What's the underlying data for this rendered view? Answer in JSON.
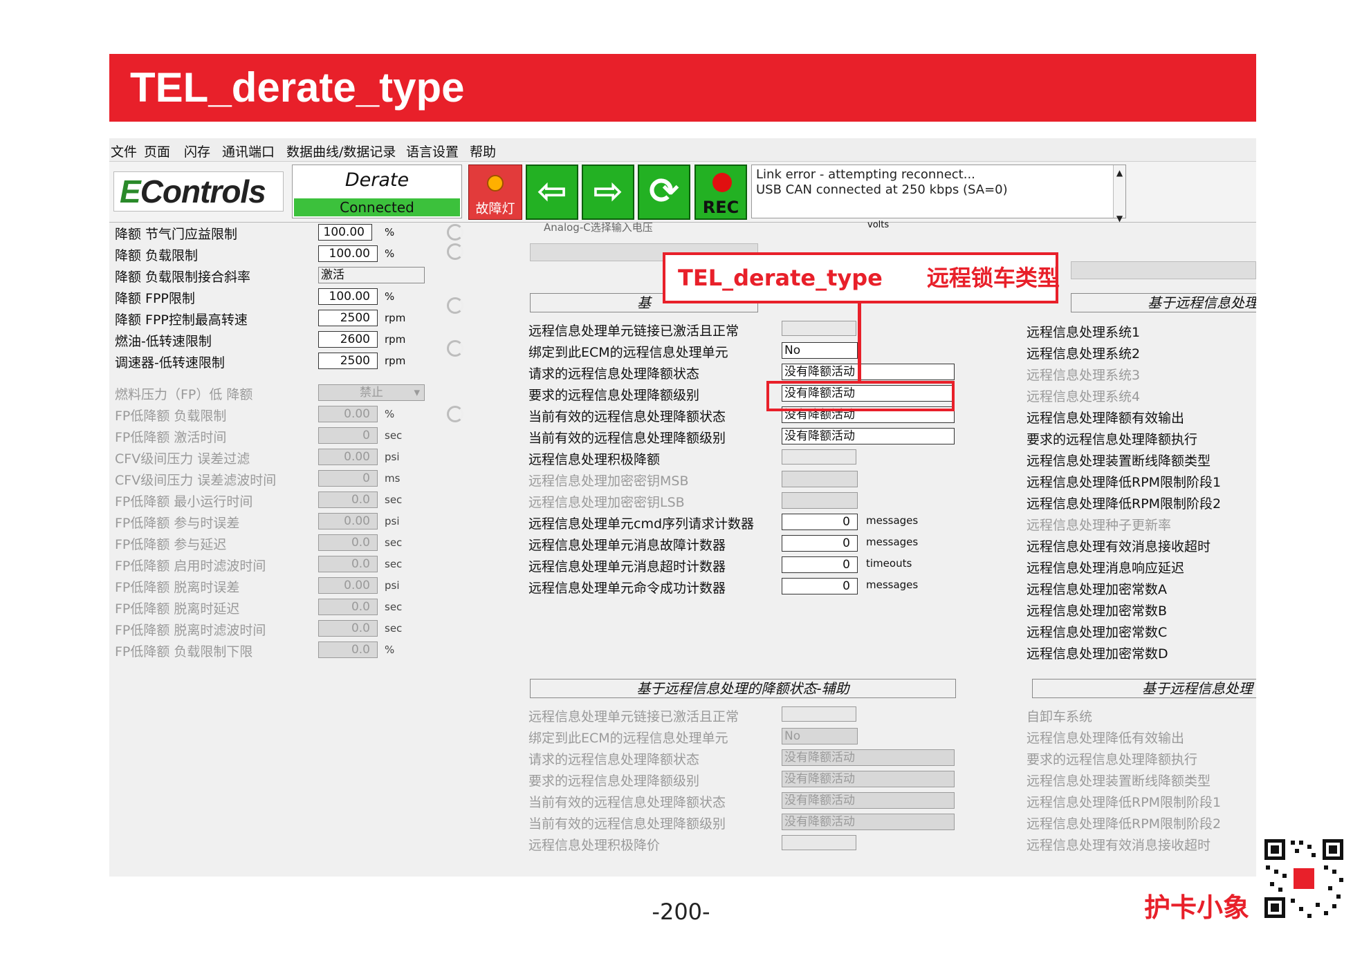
{
  "title": "TEL_derate_type",
  "menu": [
    "文件",
    "页面",
    "闪存",
    "通讯端口",
    "数据曲线/数据记录",
    "语言设置",
    "帮助"
  ],
  "toolbar": {
    "logo": "Controls",
    "status_title": "Derate",
    "status_connection": "Connected",
    "fault_label": "故障灯",
    "rec_label": "REC",
    "back_glyph": "⇦",
    "forward_glyph": "⇨",
    "refresh_glyph": "⟳",
    "log_lines": [
      "Link error - attempting reconnect...",
      "USB CAN connected at 250 kbps (SA=0)"
    ]
  },
  "left_panel": [
    {
      "label": "降额 节气门应益限制",
      "value": "100.00",
      "unit": "%",
      "dim": false
    },
    {
      "label": "降额 负载限制",
      "value": "100.00",
      "unit": "%",
      "dim": false
    },
    {
      "label": "降额 负载限制接合斜率",
      "value": "激活",
      "unit": "",
      "dim": false
    },
    {
      "label": "降额 FPP限制",
      "value": "100.00",
      "unit": "%",
      "dim": false
    },
    {
      "label": "降额 FPP控制最高转速",
      "value": "2500",
      "unit": "rpm",
      "dim": false
    },
    {
      "label": "燃油-低转速限制",
      "value": "2600",
      "unit": "rpm",
      "dim": false
    },
    {
      "label": "调速器-低转速限制",
      "value": "2500",
      "unit": "rpm",
      "dim": false
    },
    {
      "label": "燃料压力（FP）低 降额",
      "value": "禁止",
      "unit": "",
      "dim": true
    },
    {
      "label": "FP低降额 负载限制",
      "value": "0.00",
      "unit": "%",
      "dim": true
    },
    {
      "label": "FP低降额 激活时间",
      "value": "0",
      "unit": "sec",
      "dim": true
    },
    {
      "label": "CFV级间压力 误差过滤",
      "value": "0.00",
      "unit": "psi",
      "dim": true
    },
    {
      "label": "CFV级间压力 误差滤波时间",
      "value": "0",
      "unit": "ms",
      "dim": true
    },
    {
      "label": "FP低降额 最小运行时间",
      "value": "0.0",
      "unit": "sec",
      "dim": true
    },
    {
      "label": "FP低降额 参与时误差",
      "value": "0.00",
      "unit": "psi",
      "dim": true
    },
    {
      "label": "FP低降额 参与延迟",
      "value": "0.0",
      "unit": "sec",
      "dim": true
    },
    {
      "label": "FP低降额 启用时滤波时间",
      "value": "0.0",
      "unit": "sec",
      "dim": true
    },
    {
      "label": "FP低降额 脱离时误差",
      "value": "0.00",
      "unit": "psi",
      "dim": true
    },
    {
      "label": "FP低降额 脱离时延迟",
      "value": "0.0",
      "unit": "sec",
      "dim": true
    },
    {
      "label": "FP低降额 脱离时滤波时间",
      "value": "0.0",
      "unit": "sec",
      "dim": true
    },
    {
      "label": "FP低降额 负载限制下限",
      "value": "0.0",
      "unit": "%",
      "dim": true
    }
  ],
  "middle_top": {
    "partial_top_label": "Analog-C选择输入电压",
    "partial_top_unit": "volts",
    "section_head": "基",
    "rows": [
      {
        "label": "远程信息处理单元链接已激活且正常",
        "type": "ind",
        "value": ""
      },
      {
        "label": "绑定到此ECM的远程信息处理单元",
        "type": "text",
        "value": "No"
      },
      {
        "label": "请求的远程信息处理降额状态",
        "type": "wide",
        "value": "没有降额活动"
      },
      {
        "label": "要求的远程信息处理降额级别",
        "type": "wide",
        "value": "没有降额活动"
      },
      {
        "label": "当前有效的远程信息处理降额状态",
        "type": "wide",
        "value": "没有降额活动"
      },
      {
        "label": "当前有效的远程信息处理降额级别",
        "type": "wide",
        "value": "没有降额活动"
      },
      {
        "label": "远程信息处理积极降额",
        "type": "ind",
        "value": ""
      },
      {
        "label": "远程信息处理加密密钥MSB",
        "type": "sq",
        "value": "",
        "dim": true
      },
      {
        "label": "远程信息处理加密密钥LSB",
        "type": "sq",
        "value": "",
        "dim": true
      },
      {
        "label": "远程信息处理单元cmd序列请求计数器",
        "type": "num",
        "value": "0",
        "unit": "messages"
      },
      {
        "label": "远程信息处理单元消息故障计数器",
        "type": "num",
        "value": "0",
        "unit": "messages"
      },
      {
        "label": "远程信息处理单元消息超时计数器",
        "type": "num",
        "value": "0",
        "unit": "timeouts"
      },
      {
        "label": "远程信息处理单元命令成功计数器",
        "type": "num",
        "value": "0",
        "unit": "messages"
      }
    ]
  },
  "middle_bottom": {
    "section_head": "基于远程信息处理的降额状态-辅助",
    "rows": [
      {
        "label": "远程信息处理单元链接已激活且正常",
        "type": "ind",
        "value": ""
      },
      {
        "label": "绑定到此ECM的远程信息处理单元",
        "type": "text",
        "value": "No"
      },
      {
        "label": "请求的远程信息处理降额状态",
        "type": "wide",
        "value": "没有降额活动"
      },
      {
        "label": "要求的远程信息处理降额级别",
        "type": "wide",
        "value": "没有降额活动"
      },
      {
        "label": "当前有效的远程信息处理降额状态",
        "type": "wide",
        "value": "没有降额活动"
      },
      {
        "label": "当前有效的远程信息处理降额级别",
        "type": "wide",
        "value": "没有降额活动"
      },
      {
        "label": "远程信息处理积极降价",
        "type": "ind",
        "value": ""
      }
    ]
  },
  "right_top": {
    "section_head": "基于远程信息处理",
    "items": [
      {
        "label": "远程信息处理系统1",
        "dim": false
      },
      {
        "label": "远程信息处理系统2",
        "dim": false
      },
      {
        "label": "远程信息处理系统3",
        "dim": true
      },
      {
        "label": "远程信息处理系统4",
        "dim": true
      },
      {
        "label": "远程信息处理降额有效输出",
        "dim": false
      },
      {
        "label": "要求的远程信息处理降额执行",
        "dim": false
      },
      {
        "label": "远程信息处理装置断线降额类型",
        "dim": false
      },
      {
        "label": "远程信息处理降低RPM限制阶段1",
        "dim": false
      },
      {
        "label": "远程信息处理降低RPM限制阶段2",
        "dim": false
      },
      {
        "label": "远程信息处理种子更新率",
        "dim": true
      },
      {
        "label": "远程信息处理有效消息接收超时",
        "dim": false
      },
      {
        "label": "远程信息处理消息响应延迟",
        "dim": false
      },
      {
        "label": "远程信息处理加密常数A",
        "dim": false
      },
      {
        "label": "远程信息处理加密常数B",
        "dim": false
      },
      {
        "label": "远程信息处理加密常数C",
        "dim": false
      },
      {
        "label": "远程信息处理加密常数D",
        "dim": false
      }
    ]
  },
  "right_bottom": {
    "section_head": "基于远程信息处理",
    "items": [
      "自卸车系统",
      "远程信息处理降低有效输出",
      "要求的远程信息处理降额执行",
      "远程信息处理装置断线降额类型",
      "远程信息处理降低RPM限制阶段1",
      "远程信息处理降低RPM限制阶段2",
      "远程信息处理有效消息接收超时"
    ]
  },
  "callout": "TEL_derate_type　　远程锁车类型",
  "footer": {
    "page": "-200-",
    "brand": "护卡小象"
  },
  "colors": {
    "accent_red": "#e8202a",
    "button_green": "#23b123",
    "connected_green": "#3cc13c"
  }
}
